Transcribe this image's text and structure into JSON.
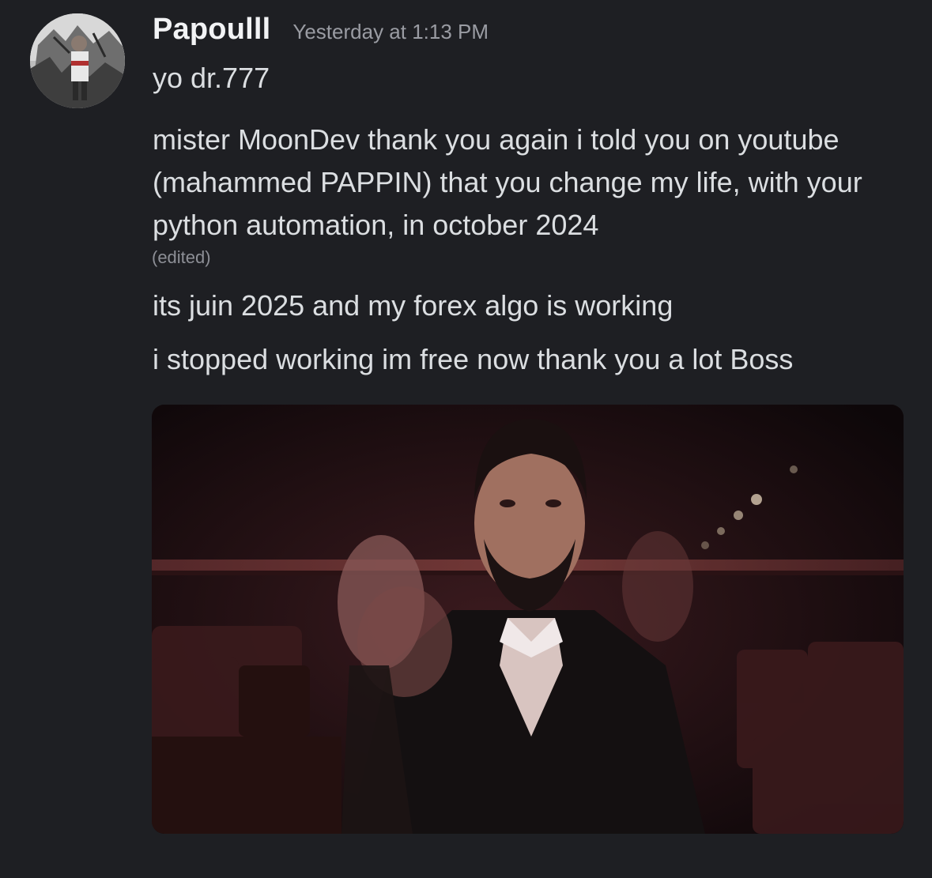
{
  "message": {
    "author": {
      "username": "Papoulll",
      "timestamp": "Yesterday at 1:13 PM",
      "avatar_icon": "user-avatar-photo"
    },
    "lines": [
      "yo dr.777",
      "mister MoonDev thank you again i told you on youtube (mahammed PAPPIN) that you change my life, with your python automation, in october 2024",
      "its juin 2025 and my forex algo is working",
      "i stopped working im free now thank you a lot Boss"
    ],
    "edited_label": "(edited)",
    "attachment": {
      "type": "gif",
      "icon": "gif-embed"
    }
  },
  "colors": {
    "background": "#1e1f23",
    "username": "#f2f3f5",
    "timestamp": "#9a9ca3",
    "message_text": "#dbdee1",
    "edited_text": "#8d8f96"
  }
}
